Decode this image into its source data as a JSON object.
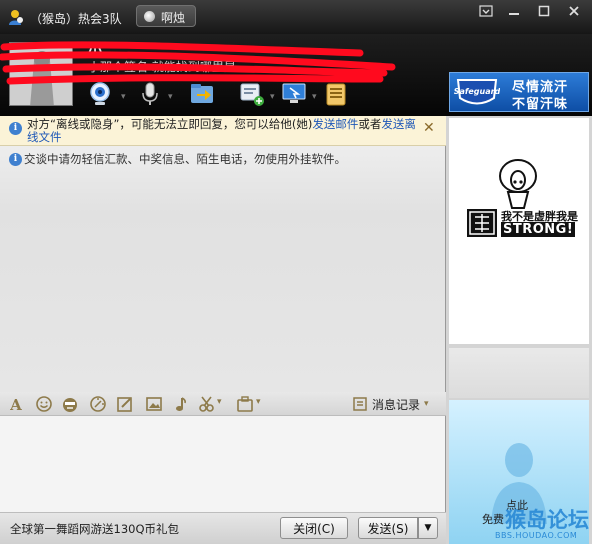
{
  "window": {
    "title": "（猴岛）热会3队",
    "status_label": "啊烛"
  },
  "header": {
    "nickname": "小",
    "signature": "小那个签名 就能找到哪里是",
    "toolbar": [
      {
        "name": "video-call-icon"
      },
      {
        "name": "voice-call-icon"
      },
      {
        "name": "send-file-icon"
      },
      {
        "name": "create-group-icon"
      },
      {
        "name": "remote-assist-icon"
      },
      {
        "name": "app-menu-icon"
      }
    ],
    "ad": {
      "line1": "尽情流汗",
      "line2": "不留汗味",
      "brand": "Safeguard"
    }
  },
  "chat": {
    "offline_notice": {
      "part1": "对方“离线或隐身”，可能无法立即回复，您可以给他(她)",
      "link1": "发送邮件",
      "part2": "或者",
      "link2": "发送离线文件"
    },
    "warning": "交谈中请勿轻信汇款、中奖信息、陌生电话，勿使用外挂软件。"
  },
  "format_toolbar": {
    "icons": [
      "font-icon",
      "emoji-icon",
      "face-icon",
      "magic-icon",
      "edit-icon",
      "image-icon",
      "music-icon",
      "screenshot-icon",
      "app-icon"
    ],
    "history_label": "消息记录"
  },
  "right_panel": {
    "show_text1": "我不是虚胖我是",
    "show_text2": "STRONG!",
    "click_text1": "点此",
    "click_text2": "免费"
  },
  "watermark": {
    "text": "猴岛论坛",
    "url": "BBS.HOUDAO.COM"
  },
  "bottom": {
    "promo": "全球第一舞蹈网游送130Q币礼包",
    "close_label": "关闭(C)",
    "send_label": "发送(S)"
  },
  "colors": {
    "accent": "#3f80cf",
    "link": "#1f58b7",
    "redaction": "#ff0a1e"
  }
}
